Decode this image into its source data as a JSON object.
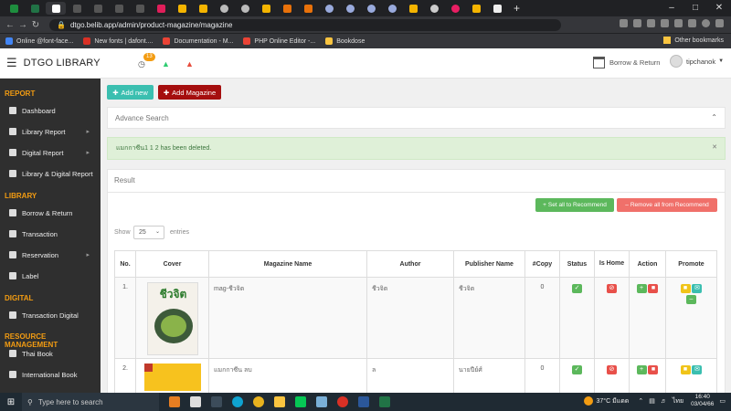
{
  "browser": {
    "url": "dtgo.belib.app/admin/product-magazine/magazine",
    "bookmarks": [
      "Online @font-face...",
      "New fonts | dafont....",
      "Documentation - M...",
      "PHP Online Editor -...",
      "Bookdose"
    ],
    "other_bookmarks": "Other bookmarks"
  },
  "header": {
    "brand": "DTGO LIBRARY",
    "notification_count": "13",
    "borrow_return": "Borrow & Return",
    "username": "tipchanok"
  },
  "sidebar": {
    "sections": [
      {
        "title": "REPORT",
        "items": [
          {
            "label": "Dashboard",
            "has_arrow": false
          },
          {
            "label": "Library Report",
            "has_arrow": true
          },
          {
            "label": "Digital Report",
            "has_arrow": true
          },
          {
            "label": "Library & Digital Report",
            "has_arrow": false
          }
        ]
      },
      {
        "title": "LIBRARY",
        "items": [
          {
            "label": "Borrow & Return",
            "has_arrow": false
          },
          {
            "label": "Transaction",
            "has_arrow": false
          },
          {
            "label": "Reservation",
            "has_arrow": true
          },
          {
            "label": "Label",
            "has_arrow": false
          }
        ]
      },
      {
        "title": "DIGITAL",
        "items": [
          {
            "label": "Transaction Digital",
            "has_arrow": false
          }
        ]
      },
      {
        "title": "RESOURCE MANAGEMENT",
        "items": [
          {
            "label": "Thai Book",
            "has_arrow": false
          },
          {
            "label": "International Book",
            "has_arrow": false
          }
        ]
      }
    ]
  },
  "toolbar": {
    "add_new": "Add new",
    "add_magazine": "Add Magazine"
  },
  "advance_search": {
    "title": "Advance Search"
  },
  "alert": {
    "message": "แมกกาซีน1 1 2 has been deleted."
  },
  "result": {
    "title": "Result",
    "set_all_recommend": "Set all to Recommend",
    "remove_all_recommend": "Remove all from Recommend",
    "show_label": "Show",
    "entries_value": "25",
    "entries_label": "entries"
  },
  "table": {
    "columns": [
      "No.",
      "Cover",
      "Magazine Name",
      "Author",
      "Publisher Name",
      "#Copy",
      "Status",
      "Is Home",
      "Action",
      "Promote"
    ],
    "rows": [
      {
        "no": "1.",
        "name": "mag-ชีวจิต",
        "author": "ชีวจิต",
        "publisher": "ชีวจิต",
        "copy": "0",
        "cover_title": "ชีวจิต"
      },
      {
        "no": "2.",
        "name": "แมกกาซีน ลบ",
        "author": "ล",
        "publisher": "นายปีย์ศ์",
        "copy": "0",
        "cover_title": ""
      }
    ]
  },
  "taskbar": {
    "search_placeholder": "Type here to search",
    "weather": "37°C มีแดด",
    "lang": "ไทย",
    "time": "16:40",
    "date": "03/04/66"
  },
  "colors": {
    "sidebar_bg": "#2f2f2f",
    "section_title": "#f39c12",
    "add_new_btn": "#3bbfb0",
    "add_magazine_btn": "#a50e0e",
    "set_recommend_btn": "#5cb85c",
    "remove_recommend_btn": "#f0706a",
    "alert_bg": "#dff0d8"
  }
}
